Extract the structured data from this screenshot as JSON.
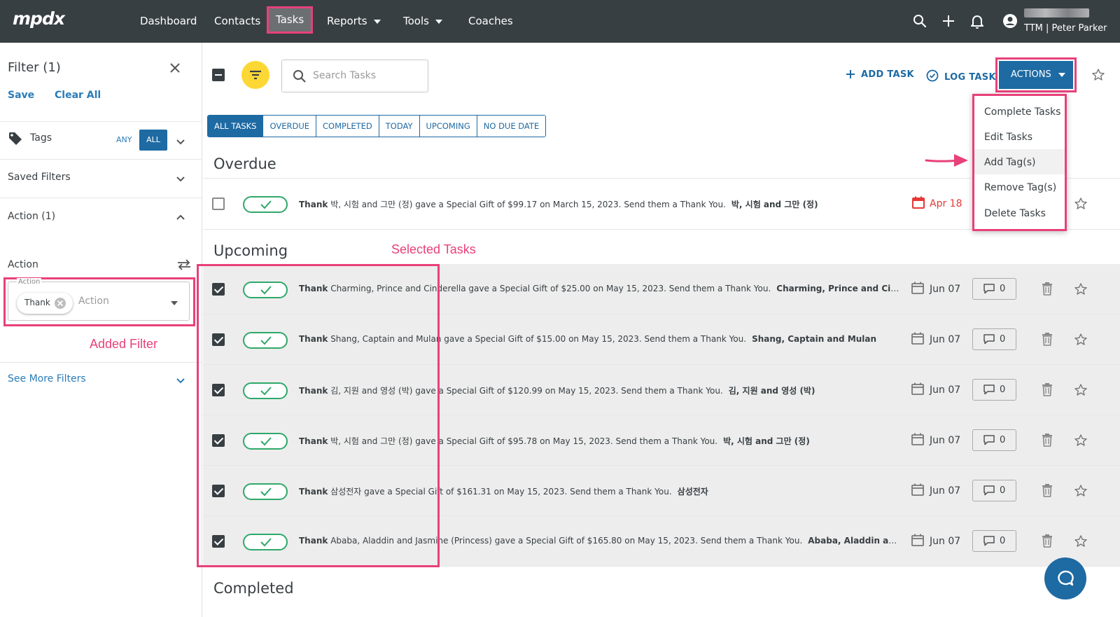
{
  "nav": {
    "logo": "mpdx",
    "items": [
      "Dashboard",
      "Contacts",
      "Tasks",
      "Reports",
      "Tools",
      "Coaches"
    ],
    "user_name": "TTM | Peter Parker"
  },
  "sidebar": {
    "title": "Filter (1)",
    "save": "Save",
    "clear_all": "Clear All",
    "tags_label": "Tags",
    "any": "ANY",
    "all": "ALL",
    "saved_filters": "Saved Filters",
    "action_group": "Action (1)",
    "action_label": "Action",
    "action_legend": "Action",
    "chip": "Thank",
    "action_placeholder": "Action",
    "see_more": "See More Filters"
  },
  "annotations": {
    "added_filter": "Added Filter",
    "selected_tasks": "Selected Tasks"
  },
  "toolbar": {
    "search_placeholder": "Search Tasks",
    "add_task": "ADD TASK",
    "log_task": "LOG TASK",
    "actions": "ACTIONS"
  },
  "tabs": [
    "ALL TASKS",
    "OVERDUE",
    "COMPLETED",
    "TODAY",
    "UPCOMING",
    "NO DUE DATE"
  ],
  "dropdown": [
    "Complete Tasks",
    "Edit Tasks",
    "Add Tag(s)",
    "Remove Tag(s)",
    "Delete Tasks"
  ],
  "sections": {
    "overdue": "Overdue",
    "upcoming": "Upcoming",
    "completed": "Completed"
  },
  "overdue_tasks": [
    {
      "action": "Thank",
      "description": "박, 시험 and 그만 (정) gave a Special Gift of $99.17 on March 15, 2023. Send them a Thank You.",
      "contact": "박, 시험 and 그만 (정)",
      "date": "Apr 18"
    }
  ],
  "upcoming_tasks": [
    {
      "action": "Thank",
      "description": "Charming, Prince and Cinderella gave a Special Gift of $25.00 on May 15, 2023. Send them a Thank You.",
      "contact": "Charming, Prince and Cinderella",
      "date": "Jun 07",
      "comments": "0"
    },
    {
      "action": "Thank",
      "description": "Shang, Captain and Mulan gave a Special Gift of $15.00 on May 15, 2023. Send them a Thank You.",
      "contact": "Shang, Captain and Mulan",
      "date": "Jun 07",
      "comments": "0"
    },
    {
      "action": "Thank",
      "description": "김, 지원 and 영성 (박) gave a Special Gift of $120.99 on May 15, 2023. Send them a Thank You.",
      "contact": "김, 지원 and 영성 (박)",
      "date": "Jun 07",
      "comments": "0"
    },
    {
      "action": "Thank",
      "description": "박, 시험 and 그만 (정) gave a Special Gift of $95.78 on May 15, 2023. Send them a Thank You.",
      "contact": "박, 시험 and 그만 (정)",
      "date": "Jun 07",
      "comments": "0"
    },
    {
      "action": "Thank",
      "description": "삼성전자 gave a Special Gift of $161.31 on May 15, 2023. Send them a Thank You.",
      "contact": "삼성전자",
      "date": "Jun 07",
      "comments": "0"
    },
    {
      "action": "Thank",
      "description": "Ababa, Aladdin and Jasmine (Princess) gave a Special Gift of $165.80 on May 15, 2023. Send them a Thank You.",
      "contact": "Ababa, Aladdin and Jasmi…",
      "date": "Jun 07",
      "comments": "0"
    }
  ]
}
